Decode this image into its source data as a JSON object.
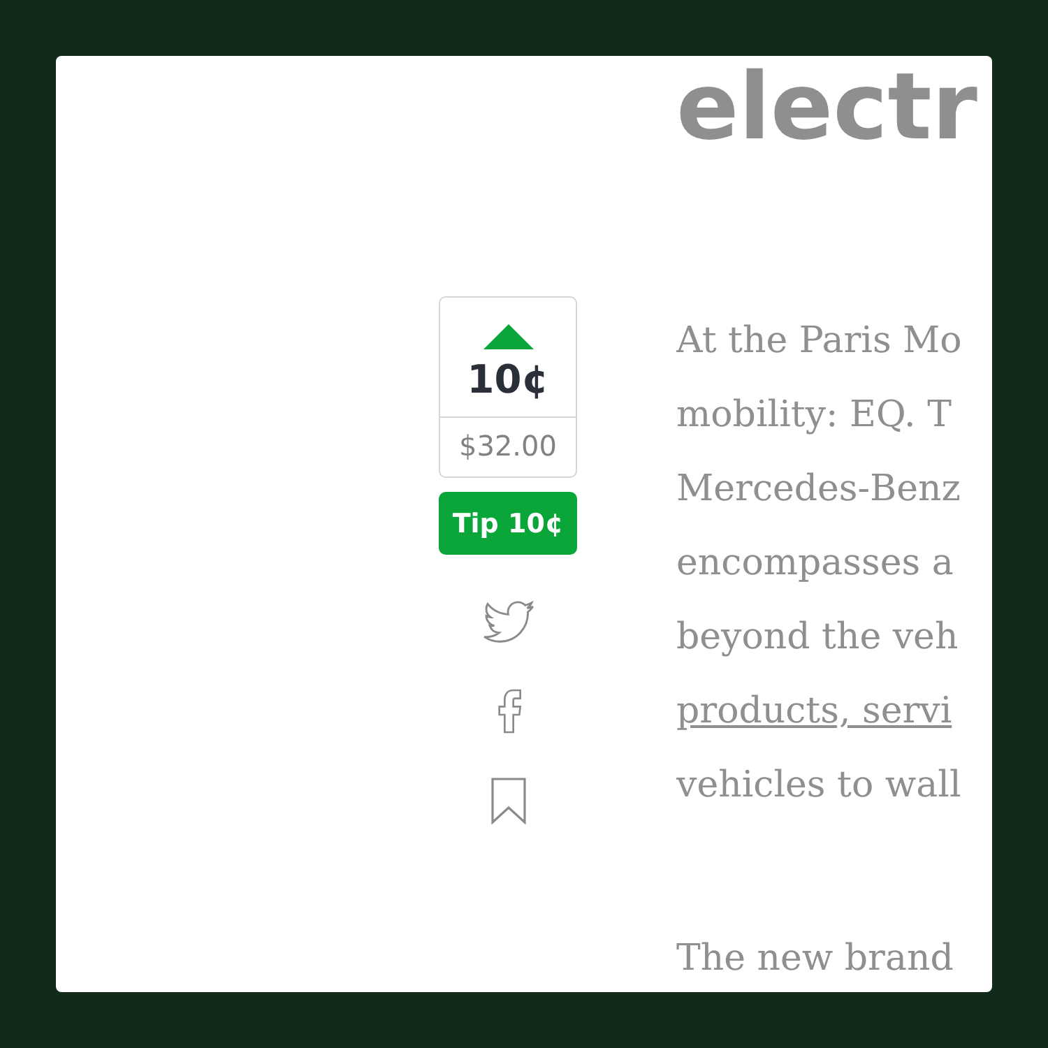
{
  "vote": {
    "count": "10¢",
    "amount": "$32.00"
  },
  "tip_button": "Tip 10¢",
  "article": {
    "title": "electr",
    "paragraphs": [
      {
        "lines": [
          {
            "kind": "text",
            "text": "At the Paris Mo"
          },
          {
            "kind": "text",
            "text": "mobility: EQ. T"
          },
          {
            "kind": "text",
            "text": "Mercedes-Benz"
          },
          {
            "kind": "text",
            "text": "encompasses a"
          },
          {
            "kind": "text",
            "text": "beyond the veh"
          },
          {
            "kind": "link",
            "text": "products, servi"
          },
          {
            "kind": "text",
            "text": "vehicles to wall"
          }
        ]
      },
      {
        "lines": [
          {
            "kind": "text",
            "text": "The new brand"
          }
        ]
      }
    ]
  }
}
